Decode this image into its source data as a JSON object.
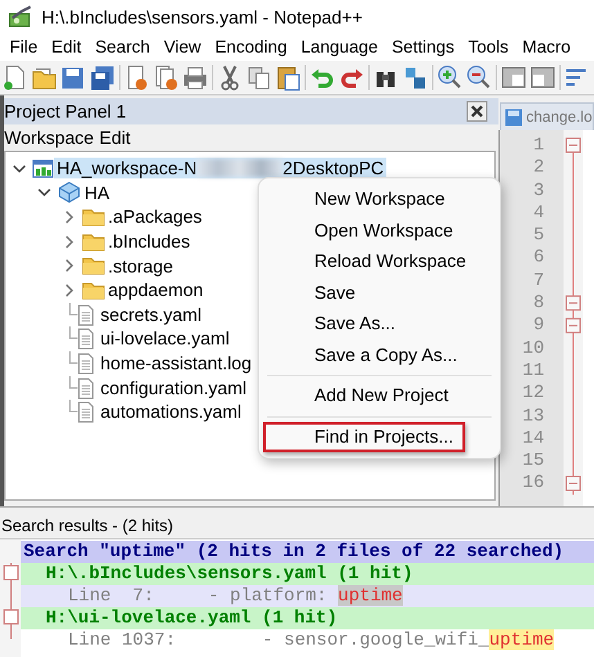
{
  "window": {
    "title": "H:\\.bIncludes\\sensors.yaml - Notepad++"
  },
  "menu_bar": [
    "File",
    "Edit",
    "Search",
    "View",
    "Encoding",
    "Language",
    "Settings",
    "Tools",
    "Macro"
  ],
  "project_panel": {
    "title": "Project Panel 1",
    "menu": [
      "Workspace",
      "Edit"
    ],
    "workspace": {
      "label_start": "HA_workspace-N",
      "label_end": "2DesktopPC",
      "expanded": true,
      "selected": true,
      "children": [
        {
          "label": "HA",
          "kind": "project",
          "expanded": true,
          "children": [
            {
              "label": ".aPackages",
              "kind": "folder",
              "expanded": false
            },
            {
              "label": ".bIncludes",
              "kind": "folder",
              "expanded": false
            },
            {
              "label": ".storage",
              "kind": "folder",
              "expanded": false
            },
            {
              "label": "appdaemon",
              "kind": "folder",
              "expanded": false
            },
            {
              "label": "secrets.yaml",
              "kind": "file"
            },
            {
              "label": "ui-lovelace.yaml",
              "kind": "file"
            },
            {
              "label": "home-assistant.log",
              "kind": "file"
            },
            {
              "label": "configuration.yaml",
              "kind": "file"
            },
            {
              "label": "automations.yaml",
              "kind": "file"
            }
          ]
        }
      ]
    }
  },
  "context_menu": {
    "items": [
      {
        "kind": "item",
        "label": "New Workspace",
        "highlighted": false
      },
      {
        "kind": "item",
        "label": "Open Workspace",
        "highlighted": false
      },
      {
        "kind": "item",
        "label": "Reload Workspace",
        "highlighted": false
      },
      {
        "kind": "item",
        "label": "Save",
        "highlighted": false
      },
      {
        "kind": "item",
        "label": "Save As...",
        "highlighted": false
      },
      {
        "kind": "item",
        "label": "Save a Copy As...",
        "highlighted": false
      },
      {
        "kind": "separator"
      },
      {
        "kind": "item",
        "label": "Add New Project",
        "highlighted": false
      },
      {
        "kind": "separator"
      },
      {
        "kind": "item",
        "label": "Find in Projects...",
        "highlighted": true
      }
    ]
  },
  "editor": {
    "tab": "change.lo",
    "line_numbers": [
      "1",
      "2",
      "3",
      "4",
      "5",
      "6",
      "7",
      "8",
      "9",
      "10",
      "11",
      "12",
      "13",
      "14",
      "15",
      "16"
    ]
  },
  "search_results": {
    "title": "Search results - (2 hits)",
    "lines": [
      {
        "kind": "header",
        "text": "Search \"uptime\" (2 hits in 2 files of 22 searched)"
      },
      {
        "kind": "file",
        "text": "H:\\.bIncludes\\sensors.yaml (1 hit)"
      },
      {
        "kind": "hit",
        "prefix": "Line  7:     - platform: ",
        "match": "uptime",
        "selected": true
      },
      {
        "kind": "file",
        "text": "H:\\ui-lovelace.yaml (1 hit)"
      },
      {
        "kind": "hit",
        "prefix": "Line 1037:        - sensor.google_wifi_",
        "match": "uptime",
        "selected": false
      }
    ]
  }
}
